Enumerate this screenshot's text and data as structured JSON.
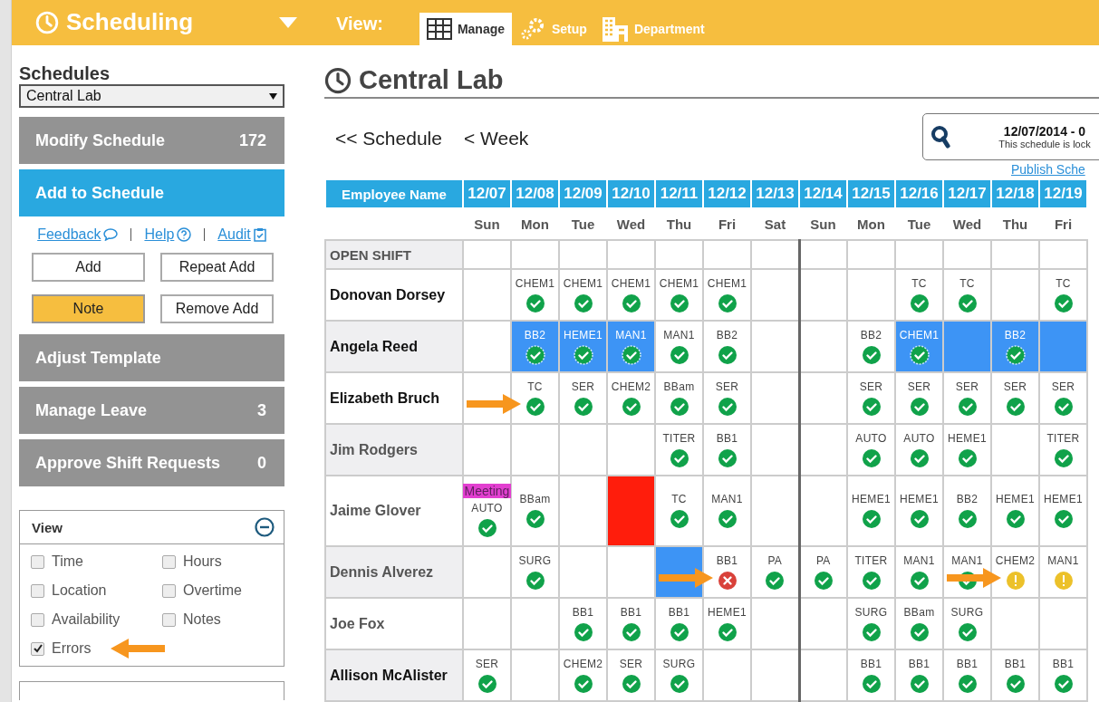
{
  "app_bar": {
    "title": "Scheduling",
    "view_label": "View:",
    "tabs": [
      {
        "label": "Manage",
        "selected": true
      },
      {
        "label": "Setup",
        "selected": false
      },
      {
        "label": "Department",
        "selected": false
      }
    ]
  },
  "sidebar": {
    "schedules_label": "Schedules",
    "schedule_select": "Central Lab",
    "menu_top": [
      {
        "label": "Modify Schedule",
        "count": "172",
        "selected": false
      },
      {
        "label": "Add to Schedule",
        "selected": true
      }
    ],
    "links": [
      {
        "label": "Feedback"
      },
      {
        "label": "Help"
      },
      {
        "label": "Audit"
      }
    ],
    "actions": [
      {
        "label": "Add",
        "selected": false
      },
      {
        "label": "Repeat Add",
        "selected": false
      },
      {
        "label": "Note",
        "selected": true
      },
      {
        "label": "Remove Add",
        "selected": false
      }
    ],
    "menu_bottom": [
      {
        "label": "Adjust Template",
        "selected": false
      },
      {
        "label": "Manage Leave",
        "count": "3",
        "selected": false
      },
      {
        "label": "Approve Shift Requests",
        "count": "0",
        "selected": false
      }
    ],
    "view_panel": {
      "title": "View",
      "expanded": true,
      "options": [
        {
          "label": "Time",
          "checked": false,
          "arrow": false
        },
        {
          "label": "Hours",
          "checked": false,
          "arrow": false
        },
        {
          "label": "Location",
          "checked": false,
          "arrow": false
        },
        {
          "label": "Overtime",
          "checked": false,
          "arrow": false
        },
        {
          "label": "Availability",
          "checked": false,
          "arrow": false
        },
        {
          "label": "Notes",
          "checked": false,
          "arrow": false
        },
        {
          "label": "Errors",
          "checked": true,
          "arrow": true
        }
      ]
    }
  },
  "main": {
    "title": "Central Lab",
    "nav": [
      "<< Schedule",
      "< Week"
    ],
    "search": {
      "range": "12/07/2014 - 0",
      "note": "This schedule is lock"
    },
    "publish_link": "Publish Sche",
    "table": {
      "name_header": "Employee Name",
      "days": [
        {
          "date": "12/07",
          "day": "Sun",
          "week_start": false
        },
        {
          "date": "12/08",
          "day": "Mon",
          "week_start": false
        },
        {
          "date": "12/09",
          "day": "Tue",
          "week_start": false
        },
        {
          "date": "12/10",
          "day": "Wed",
          "week_start": false
        },
        {
          "date": "12/11",
          "day": "Thu",
          "week_start": false
        },
        {
          "date": "12/12",
          "day": "Fri",
          "week_start": false
        },
        {
          "date": "12/13",
          "day": "Sat",
          "week_start": false
        },
        {
          "date": "12/14",
          "day": "Sun",
          "week_start": true
        },
        {
          "date": "12/15",
          "day": "Mon",
          "week_start": false
        },
        {
          "date": "12/16",
          "day": "Tue",
          "week_start": false
        },
        {
          "date": "12/17",
          "day": "Wed",
          "week_start": false
        },
        {
          "date": "12/18",
          "day": "Thu",
          "week_start": false
        },
        {
          "date": "12/19",
          "day": "Fri",
          "week_start": false
        }
      ],
      "rows": [
        {
          "name": "OPEN SHIFT",
          "kind": "open",
          "cells": [
            {
              "kind": "empty",
              "selected": false
            },
            {
              "kind": "empty",
              "selected": false
            },
            {
              "kind": "empty",
              "selected": false
            },
            {
              "kind": "empty",
              "selected": false
            },
            {
              "kind": "empty",
              "selected": false
            },
            {
              "kind": "empty",
              "selected": false
            },
            {
              "kind": "empty",
              "selected": false
            },
            {
              "kind": "empty",
              "selected": false
            },
            {
              "kind": "empty",
              "selected": false
            },
            {
              "kind": "empty",
              "selected": false
            },
            {
              "kind": "empty",
              "selected": false
            },
            {
              "kind": "empty",
              "selected": false
            },
            {
              "kind": "empty",
              "selected": false
            }
          ]
        },
        {
          "name": "Donovan Dorsey",
          "kind": "bold",
          "cells": [
            {
              "kind": "empty",
              "selected": false
            },
            {
              "kind": "check",
              "shift": "CHEM1",
              "selected": false
            },
            {
              "kind": "check",
              "shift": "CHEM1",
              "selected": false
            },
            {
              "kind": "check",
              "shift": "CHEM1",
              "selected": false
            },
            {
              "kind": "check",
              "shift": "CHEM1",
              "selected": false
            },
            {
              "kind": "check",
              "shift": "CHEM1",
              "selected": false
            },
            {
              "kind": "empty",
              "selected": false
            },
            {
              "kind": "empty",
              "selected": false
            },
            {
              "kind": "empty",
              "selected": false
            },
            {
              "kind": "check",
              "shift": "TC",
              "selected": false
            },
            {
              "kind": "check",
              "shift": "TC",
              "selected": false
            },
            {
              "kind": "empty",
              "selected": false
            },
            {
              "kind": "check",
              "shift": "TC",
              "selected": false
            }
          ]
        },
        {
          "name": "Angela Reed",
          "kind": "bold",
          "cells": [
            {
              "kind": "empty",
              "selected": false
            },
            {
              "kind": "check",
              "shift": "BB2",
              "selected": true
            },
            {
              "kind": "check",
              "shift": "HEME1",
              "selected": true
            },
            {
              "kind": "check",
              "shift": "MAN1",
              "selected": true
            },
            {
              "kind": "check",
              "shift": "MAN1",
              "selected": false
            },
            {
              "kind": "check",
              "shift": "BB2",
              "selected": false
            },
            {
              "kind": "empty",
              "selected": false
            },
            {
              "kind": "empty",
              "selected": false
            },
            {
              "kind": "check",
              "shift": "BB2",
              "selected": false
            },
            {
              "kind": "check",
              "shift": "CHEM1",
              "selected": true
            },
            {
              "kind": "empty",
              "selected": true
            },
            {
              "kind": "check",
              "shift": "BB2",
              "selected": true
            },
            {
              "kind": "empty",
              "selected": true
            }
          ]
        },
        {
          "name": "Elizabeth Bruch",
          "kind": "bold",
          "cells": [
            {
              "kind": "empty",
              "selected": false
            },
            {
              "kind": "check",
              "shift": "TC",
              "selected": false,
              "arrow": true
            },
            {
              "kind": "check",
              "shift": "SER",
              "selected": false
            },
            {
              "kind": "check",
              "shift": "CHEM2",
              "selected": false
            },
            {
              "kind": "check",
              "shift": "BBam",
              "selected": false
            },
            {
              "kind": "check",
              "shift": "SER",
              "selected": false
            },
            {
              "kind": "empty",
              "selected": false
            },
            {
              "kind": "empty",
              "selected": false
            },
            {
              "kind": "check",
              "shift": "SER",
              "selected": false
            },
            {
              "kind": "check",
              "shift": "SER",
              "selected": false
            },
            {
              "kind": "check",
              "shift": "SER",
              "selected": false
            },
            {
              "kind": "check",
              "shift": "SER",
              "selected": false
            },
            {
              "kind": "check",
              "shift": "SER",
              "selected": false
            }
          ]
        },
        {
          "name": "Jim Rodgers",
          "kind": "plain",
          "cells": [
            {
              "kind": "empty",
              "selected": false
            },
            {
              "kind": "empty",
              "selected": false
            },
            {
              "kind": "empty",
              "selected": false
            },
            {
              "kind": "empty",
              "selected": false
            },
            {
              "kind": "check",
              "shift": "TITER",
              "selected": false
            },
            {
              "kind": "check",
              "shift": "BB1",
              "selected": false
            },
            {
              "kind": "empty",
              "selected": false
            },
            {
              "kind": "empty",
              "selected": false
            },
            {
              "kind": "check",
              "shift": "AUTO",
              "selected": false
            },
            {
              "kind": "check",
              "shift": "AUTO",
              "selected": false
            },
            {
              "kind": "check",
              "shift": "HEME1",
              "selected": false
            },
            {
              "kind": "empty",
              "selected": false
            },
            {
              "kind": "check",
              "shift": "TITER",
              "selected": false
            }
          ]
        },
        {
          "name": "Jaime Glover",
          "kind": "plain",
          "cells": [
            {
              "kind": "check",
              "tag": "Meeting",
              "shift": "AUTO",
              "selected": false
            },
            {
              "kind": "check",
              "shift": "BBam",
              "selected": false
            },
            {
              "kind": "empty",
              "selected": false
            },
            {
              "kind": "blocked",
              "selected": false
            },
            {
              "kind": "check",
              "shift": "TC",
              "selected": false
            },
            {
              "kind": "check",
              "shift": "MAN1",
              "selected": false
            },
            {
              "kind": "empty",
              "selected": false
            },
            {
              "kind": "empty",
              "selected": false
            },
            {
              "kind": "check",
              "shift": "HEME1",
              "selected": false
            },
            {
              "kind": "check",
              "shift": "HEME1",
              "selected": false
            },
            {
              "kind": "check",
              "shift": "BB2",
              "selected": false
            },
            {
              "kind": "check",
              "shift": "HEME1",
              "selected": false
            },
            {
              "kind": "check",
              "shift": "HEME1",
              "selected": false
            }
          ]
        },
        {
          "name": "Dennis Alverez",
          "kind": "plain",
          "cells": [
            {
              "kind": "empty",
              "selected": false
            },
            {
              "kind": "check",
              "shift": "SURG",
              "selected": false
            },
            {
              "kind": "empty",
              "selected": false
            },
            {
              "kind": "empty",
              "selected": false
            },
            {
              "kind": "empty",
              "selected": true
            },
            {
              "kind": "error",
              "shift": "BB1",
              "selected": false,
              "arrow": true
            },
            {
              "kind": "check",
              "shift": "PA",
              "selected": false
            },
            {
              "kind": "check",
              "shift": "PA",
              "selected": false
            },
            {
              "kind": "check",
              "shift": "TITER",
              "selected": false
            },
            {
              "kind": "check",
              "shift": "MAN1",
              "selected": false
            },
            {
              "kind": "check",
              "shift": "MAN1",
              "selected": false
            },
            {
              "kind": "warning",
              "shift": "CHEM2",
              "selected": false,
              "arrow": true
            },
            {
              "kind": "warning",
              "shift": "MAN1",
              "selected": false
            }
          ]
        },
        {
          "name": "Joe Fox",
          "kind": "plain",
          "cells": [
            {
              "kind": "empty",
              "selected": false
            },
            {
              "kind": "empty",
              "selected": false
            },
            {
              "kind": "check",
              "shift": "BB1",
              "selected": false
            },
            {
              "kind": "check",
              "shift": "BB1",
              "selected": false
            },
            {
              "kind": "check",
              "shift": "BB1",
              "selected": false
            },
            {
              "kind": "check",
              "shift": "HEME1",
              "selected": false
            },
            {
              "kind": "empty",
              "selected": false
            },
            {
              "kind": "empty",
              "selected": false
            },
            {
              "kind": "check",
              "shift": "SURG",
              "selected": false
            },
            {
              "kind": "check",
              "shift": "BBam",
              "selected": false
            },
            {
              "kind": "check",
              "shift": "SURG",
              "selected": false
            },
            {
              "kind": "empty",
              "selected": false
            },
            {
              "kind": "empty",
              "selected": false
            }
          ]
        },
        {
          "name": "Allison McAlister",
          "kind": "bold",
          "cells": [
            {
              "kind": "check",
              "shift": "SER",
              "selected": false
            },
            {
              "kind": "empty",
              "selected": false
            },
            {
              "kind": "check",
              "shift": "CHEM2",
              "selected": false
            },
            {
              "kind": "check",
              "shift": "SER",
              "selected": false
            },
            {
              "kind": "check",
              "shift": "SURG",
              "selected": false
            },
            {
              "kind": "empty",
              "selected": false
            },
            {
              "kind": "empty",
              "selected": false
            },
            {
              "kind": "empty",
              "selected": false
            },
            {
              "kind": "check",
              "shift": "BB1",
              "selected": false
            },
            {
              "kind": "check",
              "shift": "BB1",
              "selected": false
            },
            {
              "kind": "check",
              "shift": "BB1",
              "selected": false
            },
            {
              "kind": "check",
              "shift": "BB1",
              "selected": false
            },
            {
              "kind": "check",
              "shift": "BB1",
              "selected": false
            }
          ]
        }
      ]
    }
  }
}
